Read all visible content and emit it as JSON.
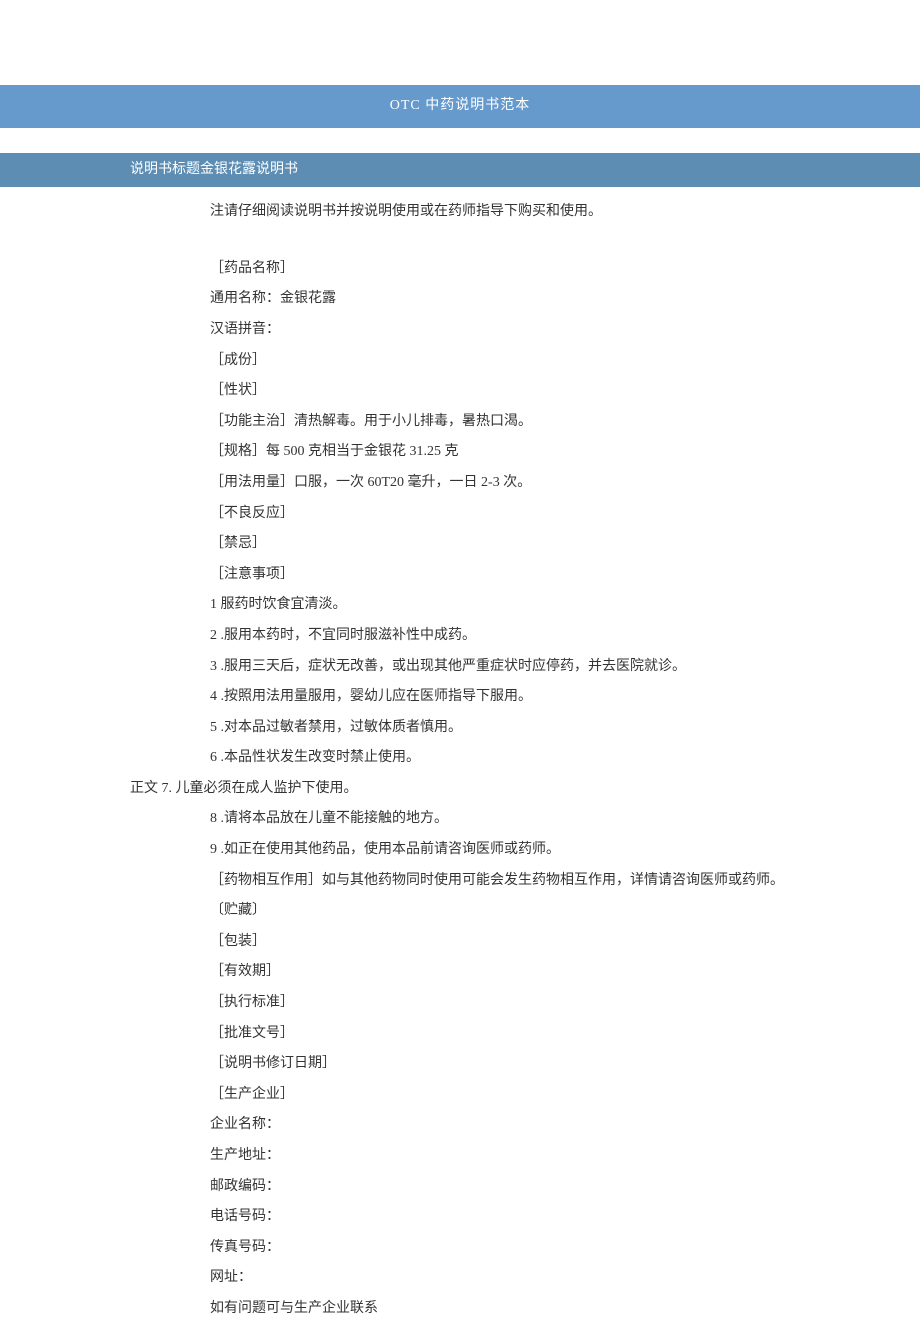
{
  "header": {
    "title": "OTC 中药说明书范本"
  },
  "sub_header": {
    "title": "说明书标题金银花露说明书"
  },
  "lines": [
    {
      "text": "注请仔细阅读说明书并按说明使用或在药师指导下购买和使用。",
      "indent": "indent-210"
    },
    {
      "text": "",
      "spacer": true
    },
    {
      "text": "［药品名称］",
      "indent": "indent-210"
    },
    {
      "text": "通用名称：金银花露",
      "indent": "indent-210"
    },
    {
      "text": "汉语拼音：",
      "indent": "indent-210"
    },
    {
      "text": "［成份］",
      "indent": "indent-210"
    },
    {
      "text": "［性状］",
      "indent": "indent-210"
    },
    {
      "text": "［功能主治］清热解毒。用于小儿排毒，暑热口渴。",
      "indent": "indent-210"
    },
    {
      "text": "［规格］每 500 克相当于金银花 31.25 克",
      "indent": "indent-210"
    },
    {
      "text": "［用法用量］口服，一次 60T20 毫升，一日 2-3 次。",
      "indent": "indent-210"
    },
    {
      "text": "［不良反应］",
      "indent": "indent-210"
    },
    {
      "text": "［禁忌］",
      "indent": "indent-210"
    },
    {
      "text": "［注意事项］",
      "indent": "indent-210"
    },
    {
      "text": "1 服药时饮食宜清淡。",
      "indent": "indent-210"
    },
    {
      "text": "2   .服用本药时，不宜同时服滋补性中成药。",
      "indent": "indent-210"
    },
    {
      "text": "3   .服用三天后，症状无改善，或出现其他严重症状时应停药，并去医院就诊。",
      "indent": "indent-210"
    },
    {
      "text": "4   .按照用法用量服用，婴幼儿应在医师指导下服用。",
      "indent": "indent-210"
    },
    {
      "text": "5   .对本品过敏者禁用，过敏体质者慎用。",
      "indent": "indent-210"
    },
    {
      "text": "6   .本品性状发生改变时禁止使用。",
      "indent": "indent-210"
    },
    {
      "text": "正文 7. 儿童必须在成人监护下使用。",
      "indent": "indent-130"
    },
    {
      "text": "8   .请将本品放在儿童不能接触的地方。",
      "indent": "indent-210"
    },
    {
      "text": "9   .如正在使用其他药品，使用本品前请咨询医师或药师。",
      "indent": "indent-210"
    },
    {
      "text": "［药物相互作用］如与其他药物同时使用可能会发生药物相互作用，详情请咨询医师或药师。",
      "indent": "indent-210"
    },
    {
      "text": "〔贮藏〕",
      "indent": "indent-210"
    },
    {
      "text": "［包装］",
      "indent": "indent-210"
    },
    {
      "text": "［有效期］",
      "indent": "indent-210"
    },
    {
      "text": "［执行标准］",
      "indent": "indent-210"
    },
    {
      "text": "［批准文号］",
      "indent": "indent-210"
    },
    {
      "text": "［说明书修订日期］",
      "indent": "indent-210"
    },
    {
      "text": "［生产企业］",
      "indent": "indent-210"
    },
    {
      "text": "企业名称：",
      "indent": "indent-210"
    },
    {
      "text": "生产地址：",
      "indent": "indent-210"
    },
    {
      "text": "邮政编码：",
      "indent": "indent-210"
    },
    {
      "text": "电话号码：",
      "indent": "indent-210"
    },
    {
      "text": "传真号码：",
      "indent": "indent-210"
    },
    {
      "text": "网址：",
      "indent": "indent-210"
    },
    {
      "text": "如有问题可与生产企业联系",
      "indent": "indent-210"
    }
  ]
}
